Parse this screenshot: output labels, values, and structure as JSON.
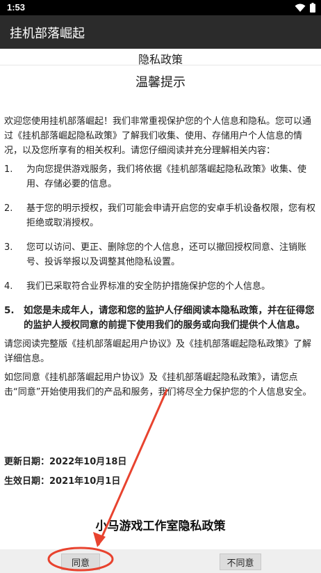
{
  "status_bar": {
    "time": "1:53",
    "icons": [
      "wifi-icon",
      "battery-icon"
    ]
  },
  "app_bar": {
    "title": "挂机部落崛起"
  },
  "document": {
    "title": "隐私政策",
    "notice_title": "温馨提示",
    "intro": "欢迎您使用挂机部落崛起！我们非常重视保护您的个人信息和隐私。您可以通过《挂机部落崛起隐私政策》了解我们收集、使用、存储用户个人信息的情况，以及您所享有的相关权利。请您仔细阅读并充分理解相关内容：",
    "items": [
      {
        "num": "1.",
        "text": "为向您提供游戏服务，我们将依据《挂机部落崛起隐私政策》收集、使用、存储必要的信息。"
      },
      {
        "num": "2.",
        "text": "基于您的明示授权，我们可能会申请开启您的安卓手机设备权限，您有权拒绝或取消授权。"
      },
      {
        "num": "3.",
        "text": "您可以访问、更正、删除您的个人信息，还可以撤回授权同意、注销账号、投诉举报以及调整其他隐私设置。"
      },
      {
        "num": "4.",
        "text": "我们已采取符合业界标准的安全防护措施保护您的个人信息。"
      },
      {
        "num": "5.",
        "text": "如您是未成年人，请您和您的监护人仔细阅读本隐私政策，并在征得您的监护人授权同意的前提下使用我们的服务或向我们提供个人信息。"
      }
    ],
    "read_full": "请您阅读完整版《挂机部落崛起用户协议》及《挂机部落崛起隐私政策》了解详细信息。",
    "agree_note": "如您同意《挂机部落崛起用户协议》及《挂机部落崛起隐私政策》，请您点击“同意”开始使用我们的产品和服务，我们将尽全力保护您的个人信息安全。",
    "update_date": "更新日期：2022年10月18日",
    "effective_date": "生效日期：2021年10月1日",
    "studio_title": "小马游戏工作室隐私政策"
  },
  "buttons": {
    "agree": "同意",
    "disagree": "不同意"
  },
  "colors": {
    "annotation": "#e8432f",
    "app_bar": "#2b2b2b",
    "status_bar": "#000000"
  }
}
